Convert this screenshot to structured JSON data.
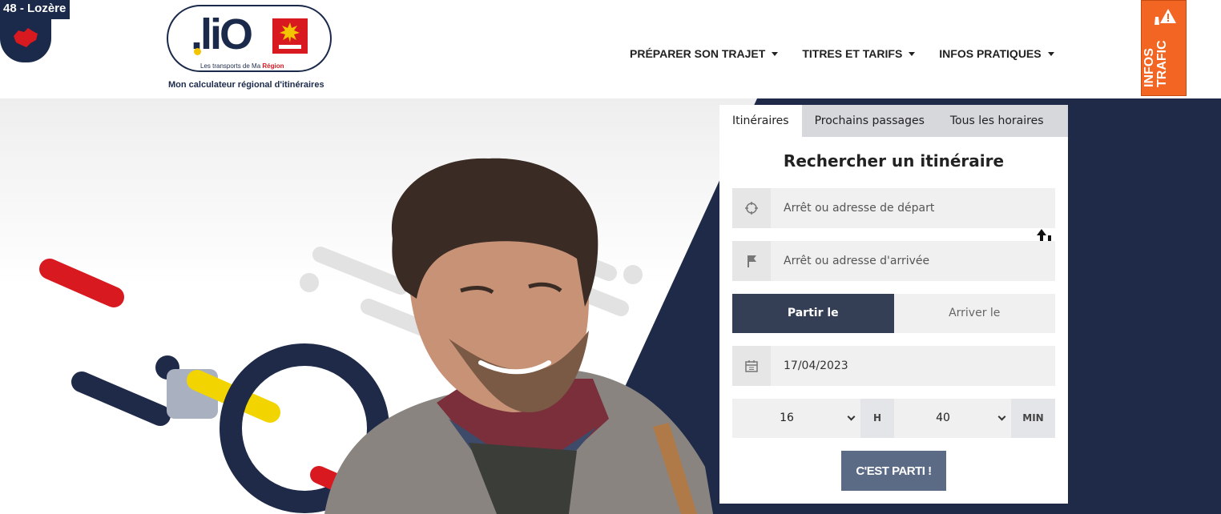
{
  "header": {
    "department": "48 - Lozère",
    "logo": {
      "wordmark": ".liO",
      "tagline_prefix": "Les transports de Ma ",
      "tagline_highlight": "Région"
    },
    "subtitle": "Mon calculateur régional d'itinéraires",
    "nav": [
      {
        "label": "PRÉPARER SON TRAJET"
      },
      {
        "label": "TITRES ET TARIFS"
      },
      {
        "label": "INFOS PRATIQUES"
      }
    ],
    "traffic_button": "INFOS TRAFIC"
  },
  "search": {
    "tabs": [
      {
        "label": "Itinéraires",
        "active": true
      },
      {
        "label": "Prochains passages",
        "active": false
      },
      {
        "label": "Tous les horaires",
        "active": false
      }
    ],
    "title": "Rechercher un itinéraire",
    "departure_placeholder": "Arrêt ou adresse de départ",
    "arrival_placeholder": "Arrêt ou adresse d'arrivée",
    "mode_depart": "Partir le",
    "mode_arrive": "Arriver le",
    "date": "17/04/2023",
    "hour": "16",
    "hour_unit": "H",
    "minute": "40",
    "minute_unit": "MIN",
    "submit": "C'EST PARTI !"
  },
  "colors": {
    "navy": "#1b2a4a",
    "accent_orange": "#f26522",
    "red": "#d81920",
    "yellow": "#f2d400",
    "button": "#5b6b86"
  }
}
